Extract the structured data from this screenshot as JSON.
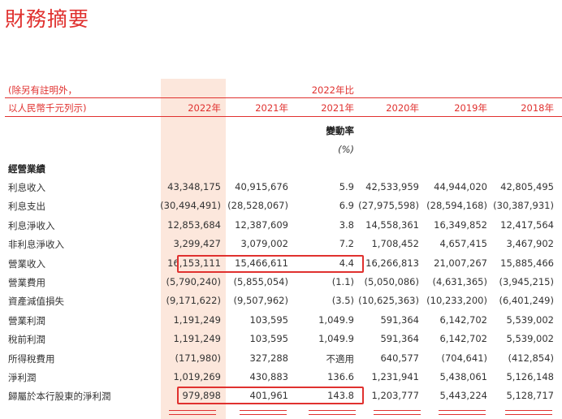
{
  "title": "財務摘要",
  "header": {
    "note_line1": "(除另有註明外，",
    "note_line2": "以人民幣千元列示)",
    "compare_line1": "2022年比",
    "years": [
      "2022年",
      "2021年",
      "2021年",
      "2020年",
      "2019年",
      "2018年"
    ],
    "change_label": "變動率",
    "percent_label": "(%)"
  },
  "section_title": "經營業績",
  "rows": [
    {
      "label": "利息收入",
      "values": [
        "43,348,175",
        "40,915,676",
        "5.9",
        "42,533,959",
        "44,944,020",
        "42,805,495"
      ]
    },
    {
      "label": "利息支出",
      "values": [
        "(30,494,491)",
        "(28,528,067)",
        "6.9",
        "(27,975,598)",
        "(28,594,168)",
        "(30,387,931)"
      ]
    },
    {
      "label": "利息淨收入",
      "values": [
        "12,853,684",
        "12,387,609",
        "3.8",
        "14,558,361",
        "16,349,852",
        "12,417,564"
      ]
    },
    {
      "label": "非利息淨收入",
      "values": [
        "3,299,427",
        "3,079,002",
        "7.2",
        "1,708,452",
        "4,657,415",
        "3,467,902"
      ]
    },
    {
      "label": "營業收入",
      "values": [
        "16,153,111",
        "15,466,611",
        "4.4",
        "16,266,813",
        "21,007,267",
        "15,885,466"
      ]
    },
    {
      "label": "營業費用",
      "values": [
        "(5,790,240)",
        "(5,855,054)",
        "(1.1)",
        "(5,050,086)",
        "(4,631,365)",
        "(3,945,215)"
      ]
    },
    {
      "label": "資產減值損失",
      "values": [
        "(9,171,622)",
        "(9,507,962)",
        "(3.5)",
        "(10,625,363)",
        "(10,233,200)",
        "(6,401,249)"
      ]
    },
    {
      "label": "營業利潤",
      "values": [
        "1,191,249",
        "103,595",
        "1,049.9",
        "591,364",
        "6,142,702",
        "5,539,002"
      ]
    },
    {
      "label": "稅前利潤",
      "values": [
        "1,191,249",
        "103,595",
        "1,049.9",
        "591,364",
        "6,142,702",
        "5,539,002"
      ]
    },
    {
      "label": "所得稅費用",
      "values": [
        "(171,980)",
        "327,288",
        "不適用",
        "640,577",
        "(704,641)",
        "(412,854)"
      ]
    },
    {
      "label": "淨利潤",
      "values": [
        "1,019,269",
        "430,883",
        "136.6",
        "1,231,941",
        "5,438,061",
        "5,126,148"
      ]
    },
    {
      "label": "歸屬於本行股東的淨利潤",
      "values": [
        "979,898",
        "401,961",
        "143.8",
        "1,203,777",
        "5,443,224",
        "5,128,717"
      ]
    }
  ],
  "colors": {
    "accent": "#e0312f",
    "highlight": "#fce7dc"
  }
}
